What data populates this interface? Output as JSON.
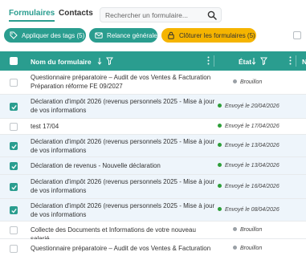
{
  "tabs": [
    {
      "label": "Formulaires",
      "active": true
    },
    {
      "label": "Contacts",
      "active": false
    }
  ],
  "search": {
    "placeholder": "Rechercher un formulaire..."
  },
  "actions": {
    "apply_tags": "Appliquer des tags (5)",
    "relance": "Relance générale",
    "close_forms": "Clôturer les formulaires (5)"
  },
  "table": {
    "col_name": "Nom du formulaire",
    "col_status": "État",
    "col_next": "N",
    "rows": [
      {
        "name": "Questionnaire préparatoire – Audit de vos Ventes & Facturation Préparation réforme FE 09/2027",
        "status": "Brouillon",
        "selected": false
      },
      {
        "name": "Déclaration d'impôt 2026 (revenus personnels 2025 - Mise à jour de vos informations",
        "status": "Envoyé le 20/04/2026",
        "selected": true
      },
      {
        "name": "test 17/04",
        "status": "Envoyé le 17/04/2026",
        "selected": false
      },
      {
        "name": "Déclaration d'impôt 2026 (revenus personnels 2025 - Mise à jour de vos informations",
        "status": "Envoyé le 13/04/2026",
        "selected": true
      },
      {
        "name": "Déclaration de revenus - Nouvelle déclaration",
        "status": "Envoyé le 13/04/2026",
        "selected": true
      },
      {
        "name": "Déclaration d'impôt 2026 (revenus personnels 2025 - Mise à jour de vos informations",
        "status": "Envoyé le 16/04/2026",
        "selected": true
      },
      {
        "name": "Déclaration d'impôt 2026 (revenus personnels 2025 - Mise à jour de vos informations",
        "status": "Envoyé le 08/04/2026",
        "selected": true
      },
      {
        "name": "Collecte des Documents et Informations de votre nouveau salarié",
        "status": "Brouillon",
        "selected": false
      },
      {
        "name": "Questionnaire préparatoire – Audit de vos Ventes & Facturation",
        "status": "Brouillon",
        "selected": false
      }
    ]
  },
  "colors": {
    "accent": "#2a9d8f",
    "warning": "#f5b400",
    "sent": "#2e9e3a",
    "draft": "#9aa0a6"
  }
}
